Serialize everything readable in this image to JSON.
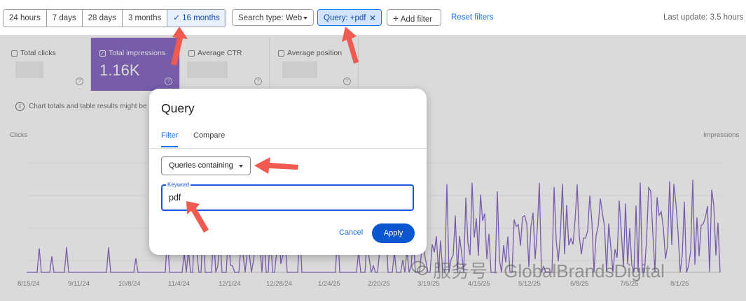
{
  "date_range": {
    "options": [
      "24 hours",
      "7 days",
      "28 days",
      "3 months",
      "16 months"
    ],
    "selected": "16 months"
  },
  "filters": {
    "search_type": "Search type: Web",
    "query": "Query: +pdf",
    "add_filter": "Add filter",
    "reset": "Reset filters"
  },
  "last_update": "Last update: 3.5 hours ag",
  "metrics": [
    {
      "label": "Total clicks",
      "value": "",
      "checked": false
    },
    {
      "label": "Total impressions",
      "value": "1.16K",
      "checked": true
    },
    {
      "label": "Average CTR",
      "value": "",
      "checked": false
    },
    {
      "label": "Average position",
      "value": "",
      "checked": false
    }
  ],
  "notice": "Chart totals and table results might be par",
  "chart": {
    "left_axis": "Clicks",
    "right_axis": "Impressions",
    "x_ticks": [
      "8/15/24",
      "9/11/24",
      "10/8/24",
      "11/4/24",
      "12/1/24",
      "12/28/24",
      "1/24/25",
      "2/20/25",
      "3/19/25",
      "4/15/25",
      "5/12/25",
      "6/8/25",
      "7/5/25",
      "8/1/25"
    ],
    "series_color": "#5e35b1"
  },
  "dialog": {
    "title": "Query",
    "tabs": [
      "Filter",
      "Compare"
    ],
    "active_tab": "Filter",
    "mode": "Queries containing",
    "keyword_label": "Keyword",
    "keyword_value": "pdf",
    "cancel": "Cancel",
    "apply": "Apply"
  },
  "watermark": "服务号 · GlobalBrandsDigital",
  "colors": {
    "accent": "#1a73e8",
    "selected_card": "#5e35b1",
    "annotation": "#f05a50"
  }
}
